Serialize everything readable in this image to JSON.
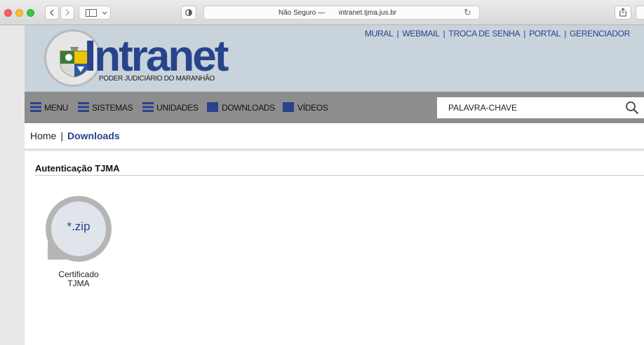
{
  "browser": {
    "security_label": "Não Seguro —",
    "url": "intranet.tjma.jus.br"
  },
  "header": {
    "logo_word": "Intranet",
    "logo_subtitle": "PODER JUDICIÁRIO DO MARANHÃO",
    "top_links": [
      "MURAL",
      "WEBMAIL",
      "TROCA DE SENHA",
      "PORTAL",
      "GERENCIADOR"
    ],
    "top_link_separator": "|"
  },
  "nav": {
    "items": [
      {
        "label": "MENU",
        "icon": "hamburger-icon"
      },
      {
        "label": "SISTEMAS",
        "icon": "hamburger-icon"
      },
      {
        "label": "UNIDADES",
        "icon": "hamburger-icon"
      },
      {
        "label": "DOWNLOADS",
        "icon": "square-icon"
      },
      {
        "label": "VÍDEOS",
        "icon": "square-icon"
      }
    ],
    "search_placeholder": "PALAVRA-CHAVE"
  },
  "breadcrumb": {
    "home": "Home",
    "separator": "|",
    "current": "Downloads"
  },
  "content": {
    "section_title": "Autenticação TJMA",
    "downloads": [
      {
        "icon_text": "*.zip",
        "label_line1": "Certificado",
        "label_line2": "TJMA"
      }
    ]
  },
  "colors": {
    "brand_blue": "#27448b",
    "header_bg": "#c9d3dc",
    "nav_bg": "#8d8d8d"
  }
}
